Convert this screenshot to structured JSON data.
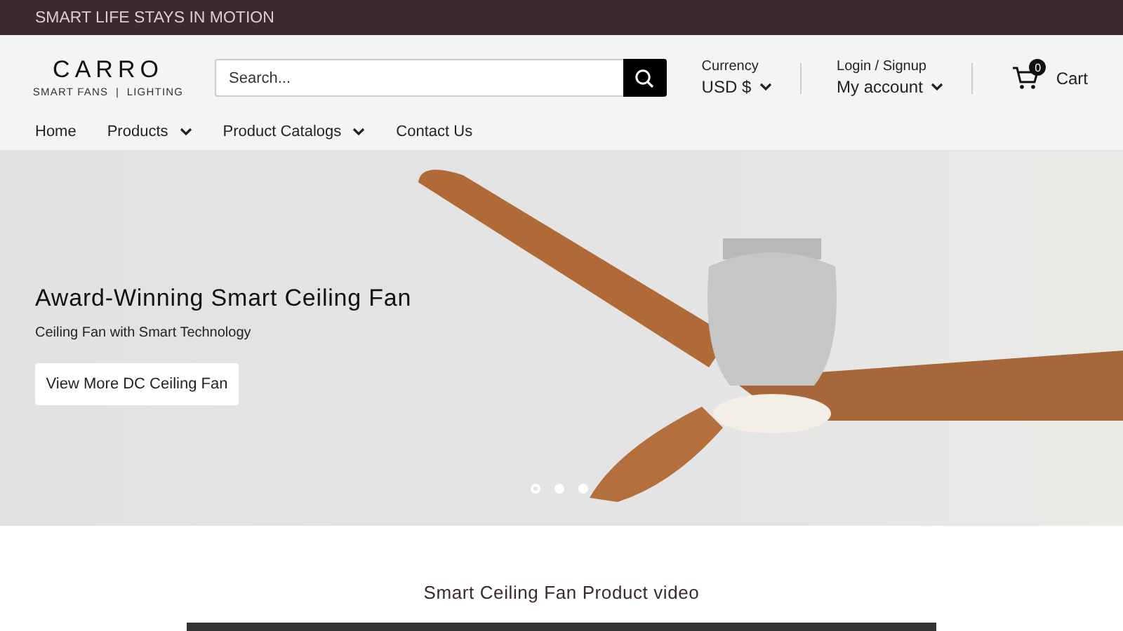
{
  "announcement": "SMART LIFE STAYS IN MOTION",
  "logo": {
    "name": "CARRO",
    "tagline": "SMART FANS  |  LIGHTING"
  },
  "search": {
    "placeholder": "Search..."
  },
  "currency": {
    "label": "Currency",
    "value": "USD $"
  },
  "account": {
    "label": "Login / Signup",
    "value": "My account"
  },
  "cart": {
    "count": "0",
    "label": "Cart"
  },
  "nav": [
    {
      "label": "Home",
      "dropdown": false
    },
    {
      "label": "Products",
      "dropdown": true
    },
    {
      "label": "Product Catalogs",
      "dropdown": true
    },
    {
      "label": "Contact Us",
      "dropdown": false
    }
  ],
  "hero": {
    "title": "Award-Winning Smart Ceiling Fan",
    "subtitle": "Ceiling Fan with Smart Technology",
    "button": "View More DC Ceiling Fan",
    "dots": [
      {
        "selected": true
      },
      {
        "selected": false
      },
      {
        "selected": false
      }
    ]
  },
  "video_section": {
    "title": "Smart Ceiling Fan Product video"
  }
}
